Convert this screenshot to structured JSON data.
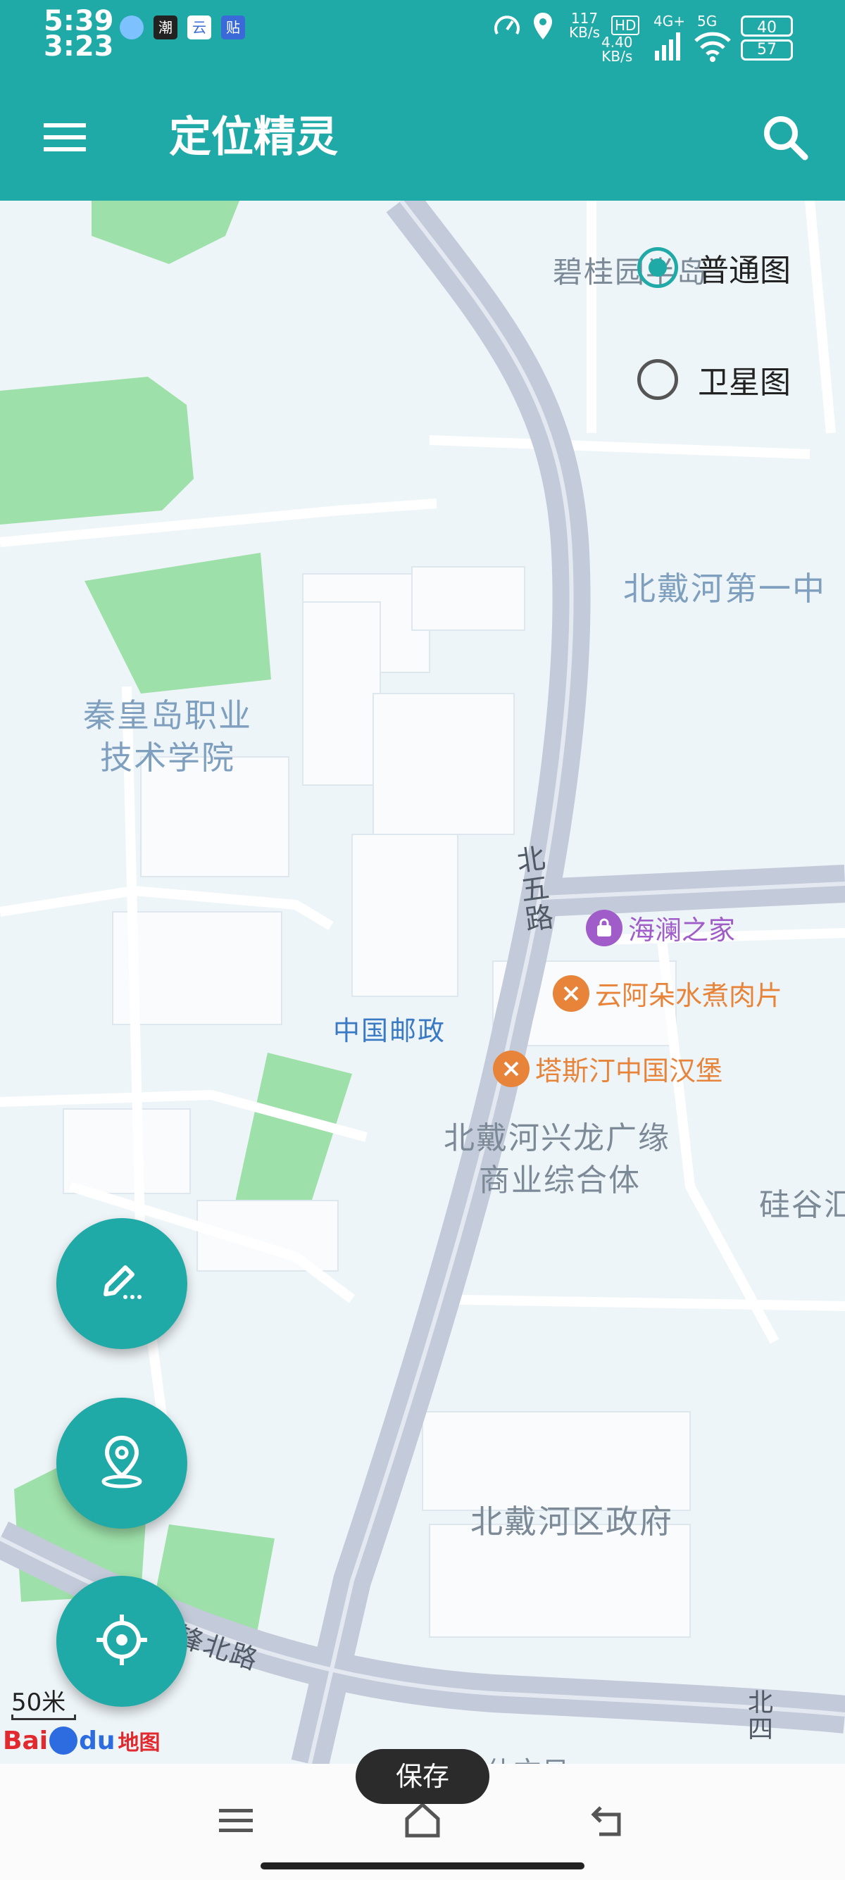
{
  "status_bar": {
    "time_top": "5:39",
    "time_bottom": "3:23",
    "net_speed_top": "117",
    "net_speed_unit_top": "KB/s",
    "net_speed_bottom": "4.40",
    "net_speed_unit_bottom": "KB/s",
    "hd_badge": "HD",
    "network_4g": "4G+",
    "network_5g": "5G",
    "battery_top": "40",
    "battery_bottom": "57",
    "app_icon_labels": [
      "潮",
      "云",
      "贴"
    ]
  },
  "app_bar": {
    "title": "定位精灵",
    "menu_icon": "hamburger-menu-icon",
    "search_icon": "search-icon"
  },
  "map_type": {
    "options": [
      {
        "label": "普通图",
        "selected": true
      },
      {
        "label": "卫星图",
        "selected": false
      }
    ]
  },
  "map_labels": {
    "bigui": "碧桂园半岛",
    "school_line1": "秦皇岛职业",
    "school_line2": "技术学院",
    "middle_school": "北戴河第一中",
    "road_beiwu": "北五路",
    "post_office": "中国邮政",
    "plaza_line1": "北戴河兴龙广缘",
    "plaza_line2": "商业综合体",
    "silicon": "硅谷汇",
    "gov": "北戴河区政府",
    "road_north": "锋北路",
    "road_beisi": "北四",
    "bottom_partial": "家什文目"
  },
  "pois": [
    {
      "name": "海澜之家",
      "color": "#a05cc8",
      "icon": "shopping-bag-icon"
    },
    {
      "name": "云阿朵水煮肉片",
      "color": "#e8843a",
      "icon": "restaurant-icon"
    },
    {
      "name": "塔斯汀中国汉堡",
      "color": "#e8843a",
      "icon": "restaurant-icon"
    }
  ],
  "fabs": [
    {
      "name": "edit-button",
      "icon": "edit-pencil-icon"
    },
    {
      "name": "location-pin-button",
      "icon": "location-pin-icon"
    },
    {
      "name": "my-location-button",
      "icon": "crosshair-icon"
    }
  ],
  "scale": "50米",
  "baidu_logo": {
    "text_left": "Bai",
    "text_right": "du",
    "text_cn": "地图"
  },
  "toast": "保存",
  "colors": {
    "primary": "#1fa9a7",
    "map_bg": "#eef5f8",
    "park": "#9ee0a9",
    "road": "#c3cad9"
  }
}
